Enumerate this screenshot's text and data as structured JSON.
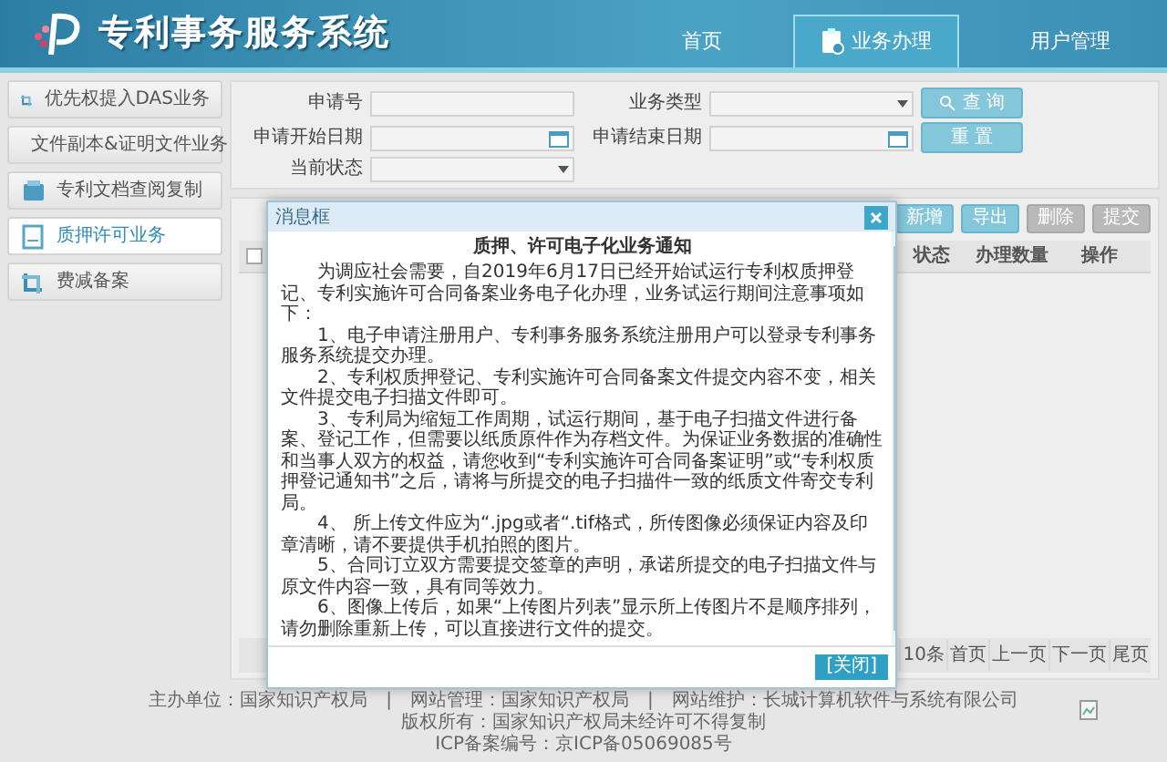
{
  "header": {
    "title": "专利事务服务系统",
    "nav": [
      {
        "label": "首页",
        "selected": false
      },
      {
        "label": "业务办理",
        "selected": true
      },
      {
        "label": "用户管理",
        "selected": false
      }
    ]
  },
  "sidebar": {
    "items": [
      {
        "label": "优先权提入DAS业务",
        "kind": "das",
        "selected": false
      },
      {
        "label": "文件副本&证明文件业务",
        "kind": "doc",
        "selected": false
      },
      {
        "label": "专利文档查阅复制",
        "kind": "copy",
        "selected": false
      },
      {
        "label": "质押许可业务",
        "kind": "pledge",
        "selected": true
      },
      {
        "label": "费减备案",
        "kind": "fee",
        "selected": false
      }
    ]
  },
  "search_form": {
    "fields": [
      {
        "label": "申请号",
        "kind": "text"
      },
      {
        "label": "业务类型",
        "kind": "select"
      },
      {
        "label": "申请开始日期",
        "kind": "date"
      },
      {
        "label": "申请结束日期",
        "kind": "date"
      },
      {
        "label": "当前状态",
        "kind": "select"
      }
    ],
    "buttons": [
      {
        "label": "查 询",
        "kind": "search"
      },
      {
        "label": "重 置",
        "kind": "reset"
      }
    ]
  },
  "table": {
    "toolbar": [
      {
        "label": "新增",
        "disabled": false
      },
      {
        "label": "导出",
        "disabled": false
      },
      {
        "label": "删除",
        "disabled": true
      },
      {
        "label": "提交",
        "disabled": true
      }
    ],
    "select_all": {
      "checked": false
    },
    "columns": [
      "状态",
      "办理数量",
      "操作"
    ],
    "pagination": [
      "10条",
      "首页",
      "上一页",
      "下一页",
      "尾页"
    ]
  },
  "dialog": {
    "title": "消息框",
    "heading": "质押、许可电子化业务通知",
    "paragraphs": [
      "为调应社会需要，自2019年6月17日已经开始试运行专利权质押登记、专利实施许可合同备案业务电子化办理，业务试运行期间注意事项如下：",
      "1、电子申请注册用户、专利事务服务系统注册用户可以登录专利事务服务系统提交办理。",
      "2、专利权质押登记、专利实施许可合同备案文件提交内容不变，相关文件提交电子扫描文件即可。",
      "3、专利局为缩短工作周期，试运行期间，基于电子扫描文件进行备案、登记工作，但需要以纸质原件作为存档文件。为保证业务数据的准确性和当事人双方的权益，请您收到“专利实施许可合同备案证明”或“专利权质押登记通知书”之后，请将与所提交的电子扫描件一致的纸质文件寄交专利局。",
      "4、 所上传文件应为“.jpg或者“.tif格式，所传图像必须保证内容及印章清晰，请不要提供手机拍照的图片。",
      "5、合同订立双方需要提交签章的声明，承诺所提交的电子扫描文件与原文件内容一致，具有同等效力。",
      "6、图像上传后，如果“上传图片列表”显示所上传图片不是顺序排列，请勿删除重新上传，可以直接进行文件的提交。"
    ],
    "button": "[关闭]"
  },
  "footer": {
    "lines": [
      "主办单位：国家知识产权局　|　网站管理：国家知识产权局　|　网站维护：长城计算机软件与系统有限公司",
      "版权所有：国家知识产权局未经许可不得复制",
      "ICP备案编号：京ICP备05069085号"
    ]
  }
}
